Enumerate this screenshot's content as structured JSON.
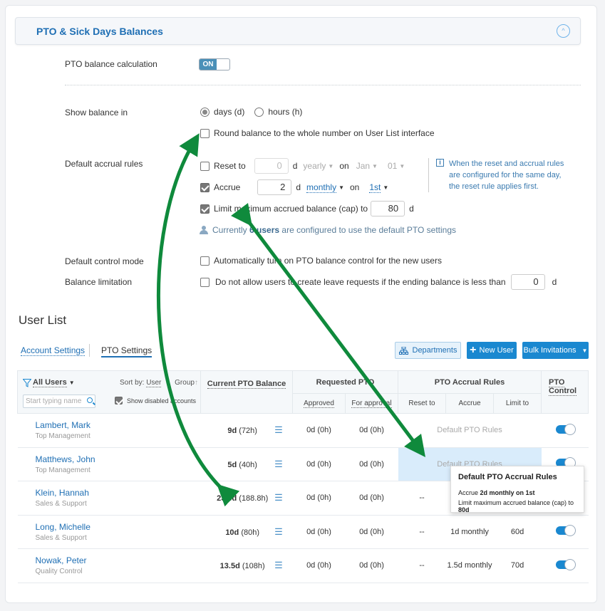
{
  "panel": {
    "title": "PTO & Sick Days Balances",
    "collapse_icon": "chevron-up-icon"
  },
  "settings": {
    "pto_calc": {
      "label": "PTO balance calculation",
      "toggle": "ON",
      "on": true
    },
    "show_balance": {
      "label": "Show balance in",
      "options": [
        "days (d)",
        "hours (h)"
      ],
      "selected": "days (d)"
    },
    "round_balance": {
      "label": "Round balance to the whole number on User List interface",
      "checked": false
    },
    "accrual": {
      "label": "Default accrual rules",
      "reset": {
        "label": "Reset to",
        "checked": false,
        "value": "0",
        "unit": "d",
        "period": "yearly",
        "on": "on",
        "month": "Jan",
        "day": "01"
      },
      "accrue": {
        "label": "Accrue",
        "checked": true,
        "value": "2",
        "unit": "d",
        "period": "monthly",
        "on": "on",
        "day": "1st"
      },
      "cap": {
        "label": "Limit maximum accrued balance (cap) to",
        "checked": true,
        "value": "80",
        "unit": "d"
      },
      "info": "When the reset and accrual rules are configured for the same day, the reset rule applies first.",
      "users_note_pre": "Currently",
      "users_note_count": "6 users",
      "users_note_post": "are configured to use the default PTO settings"
    },
    "control_mode": {
      "label": "Default control mode",
      "text": "Automatically turn on PTO balance control for the new users",
      "checked": false
    },
    "balance_limit": {
      "label": "Balance limitation",
      "text": "Do not allow users to create leave requests if the ending balance is less than",
      "value": "0",
      "unit": "d",
      "checked": false
    }
  },
  "user_list": {
    "title": "User List",
    "tabs": [
      {
        "label": "Account Settings"
      },
      {
        "label": "PTO Settings",
        "active": true
      }
    ],
    "buttons": {
      "departments": "Departments",
      "new_user": "New User",
      "bulk": "Bulk Invitations"
    },
    "filter": {
      "label": "All Users",
      "sort_by": "Sort by:",
      "sort_user": "User",
      "sort_group": "Group",
      "search_placeholder": "Start typing name",
      "show_disabled": "Show disabled accounts",
      "show_disabled_checked": true
    },
    "headers": {
      "balance": "Current PTO Balance",
      "requested": "Requested PTO",
      "approved": "Approved",
      "for_approval": "For approval",
      "accrual": "PTO Accrual Rules",
      "reset_to": "Reset to",
      "accrue": "Accrue",
      "limit_to": "Limit to",
      "control": "PTO Control"
    },
    "rows": [
      {
        "name": "Lambert, Mark",
        "dept": "Top Management",
        "bal_d": "9d",
        "bal_h": "(72h)",
        "approved": "0d (0h)",
        "for_approval": "0d (0h)",
        "rules": "Default PTO Rules",
        "control": true
      },
      {
        "name": "Matthews, John",
        "dept": "Top Management",
        "bal_d": "5d",
        "bal_h": "(40h)",
        "approved": "0d (0h)",
        "for_approval": "0d (0h)",
        "rules": "Default PTO Rules",
        "control": true
      },
      {
        "name": "Klein, Hannah",
        "dept": "Sales & Support",
        "bal_d": "23.6d",
        "bal_h": "(188.8h)",
        "approved": "0d (0h)",
        "for_approval": "0d (0h)",
        "reset": "--",
        "accrue": "",
        "limit": "",
        "control": true
      },
      {
        "name": "Long, Michelle",
        "dept": "Sales & Support",
        "bal_d": "10d",
        "bal_h": "(80h)",
        "approved": "0d (0h)",
        "for_approval": "0d (0h)",
        "reset": "--",
        "accrue": "1d monthly",
        "limit": "60d",
        "control": true
      },
      {
        "name": "Nowak, Peter",
        "dept": "Quality Control",
        "bal_d": "13.5d",
        "bal_h": "(108h)",
        "approved": "0d (0h)",
        "for_approval": "0d (0h)",
        "reset": "--",
        "accrue": "1.5d monthly",
        "limit": "70d",
        "control": true
      }
    ],
    "tooltip": {
      "title": "Default PTO Accrual Rules",
      "line1_pre": "Accrue ",
      "line1_bold": "2d monthly on 1st",
      "line2_pre": "Limit maximum accrued balance (cap) to ",
      "line2_bold": "80d"
    }
  },
  "annotation_color": "#0f8a3c"
}
